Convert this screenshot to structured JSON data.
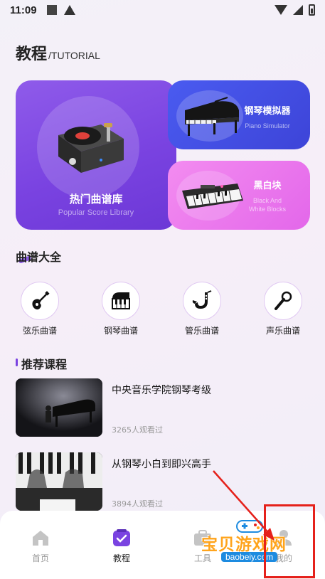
{
  "status_bar": {
    "time": "11:09"
  },
  "header": {
    "title": "教程",
    "subtitle": "/TUTORIAL"
  },
  "cards": {
    "popular": {
      "title": "热门曲谱库",
      "subtitle": "Popular Score Library"
    },
    "piano": {
      "title": "钢琴模拟器",
      "subtitle": "Piano Simulator"
    },
    "black_blocks": {
      "title": "黑白块",
      "subtitle_line1": "Black And",
      "subtitle_line2": "White Blocks"
    }
  },
  "scores_section": {
    "title": "曲谱大全",
    "categories": [
      {
        "label": "弦乐曲谱",
        "icon": "guitar-icon"
      },
      {
        "label": "钢琴曲谱",
        "icon": "piano-keys-icon"
      },
      {
        "label": "管乐曲谱",
        "icon": "saxophone-icon"
      },
      {
        "label": "声乐曲谱",
        "icon": "microphone-icon"
      }
    ]
  },
  "courses_section": {
    "title": "推荐课程",
    "items": [
      {
        "title": "中央音乐学院钢琴考级",
        "views": "3265人观看过"
      },
      {
        "title": "从钢琴小白到即兴高手",
        "views": "3894人观看过"
      }
    ]
  },
  "bottom_nav": {
    "items": [
      {
        "label": "首页",
        "icon": "home-icon",
        "active": false
      },
      {
        "label": "教程",
        "icon": "checkbox-icon",
        "active": true
      },
      {
        "label": "工具",
        "icon": "toolbox-icon",
        "active": false
      },
      {
        "label": "我的",
        "icon": "profile-icon",
        "active": false
      }
    ]
  },
  "watermark": {
    "text": "宝贝游戏网",
    "url": "baobeiy.com"
  },
  "colors": {
    "accent": "#7a43e1",
    "piano_card": "#4a5bf0",
    "black_card": "#e367ea",
    "annotation_red": "#e5211b",
    "watermark_orange": "#ffa41c"
  }
}
